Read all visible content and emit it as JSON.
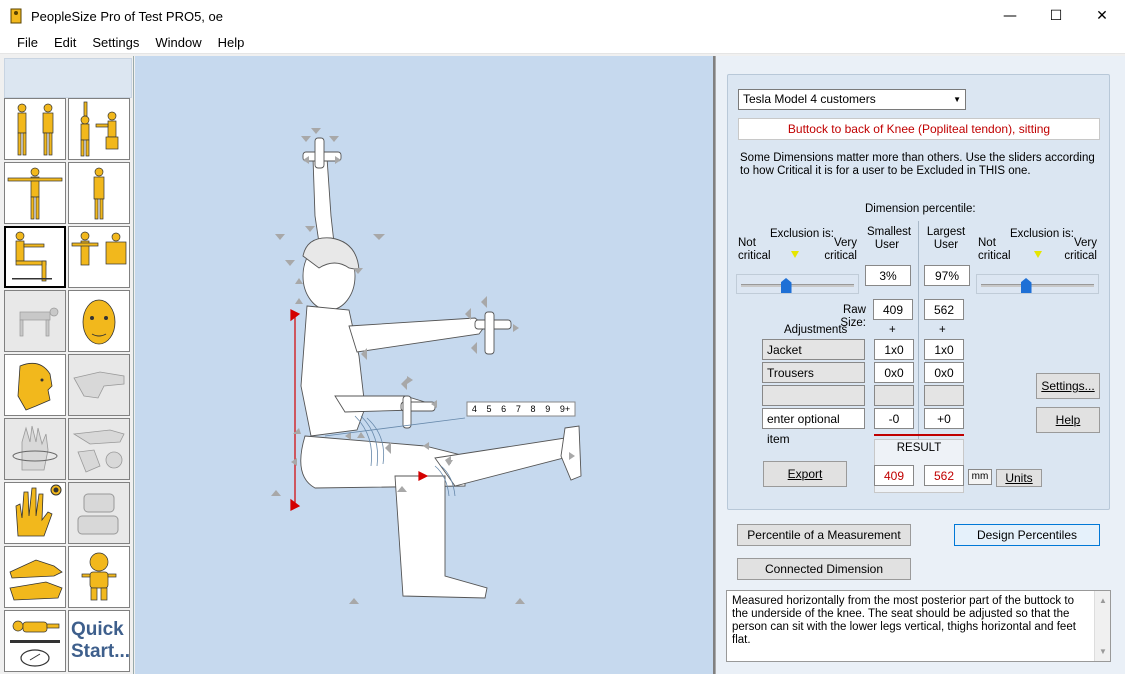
{
  "window": {
    "title": "PeopleSize Pro of Test PRO5, oe",
    "minimize": "—",
    "maximize": "☐",
    "close": "✕"
  },
  "menu": [
    "File",
    "Edit",
    "Settings",
    "Window",
    "Help"
  ],
  "palette": {
    "quick_start": "Quick Start..."
  },
  "canvas": {
    "ruler_labels": [
      "4",
      "5",
      "6",
      "7",
      "8",
      "9",
      "9+"
    ]
  },
  "panel": {
    "dataset": "Tesla Model 4 customers",
    "dimension_name": "Buttock to back of Knee (Popliteal tendon), sitting",
    "instructions": "Some Dimensions matter more than others. Use the sliders according to how Critical it is for a user to be Excluded in THIS one.",
    "dimension_percentile_label": "Dimension percentile:",
    "smallest_user_label": "Smallest User",
    "largest_user_label": "Largest User",
    "exclusion_label": "Exclusion is:",
    "not_critical": "Not critical",
    "very_critical": "Very critical",
    "smallest_percentile": "3%",
    "largest_percentile": "97%",
    "raw_size_label": "Raw Size:",
    "raw_small": "409",
    "raw_large": "562",
    "adjustments_label": "Adjustments",
    "plus": "+",
    "adjustments": [
      {
        "name": "Jacket",
        "small": "1x0",
        "large": "1x0"
      },
      {
        "name": "Trousers",
        "small": "0x0",
        "large": "0x0"
      },
      {
        "name": "",
        "small": "",
        "large": ""
      },
      {
        "name": "enter optional item",
        "small": "-0",
        "large": "+0"
      }
    ],
    "result_label": "RESULT",
    "result_small": "409",
    "result_large": "562",
    "units_value": "mm",
    "units_button": "Units",
    "export_button": "Export",
    "settings_button": "Settings...",
    "help_button": "Help",
    "slider_left_fraction": 0.38,
    "slider_right_fraction": 0.38
  },
  "modes": {
    "percentile_of_measurement": "Percentile of a Measurement",
    "design_percentiles": "Design Percentiles",
    "connected_dimension": "Connected Dimension"
  },
  "description": "Measured horizontally from the most posterior part of the buttock to the underside of the knee. The seat should be adjusted so that the person can sit with the lower legs vertical, thighs horizontal and feet flat.",
  "colors": {
    "canvas_bg": "#c6d9ee",
    "accent_red": "#c00000",
    "icon_orange": "#f2b81c",
    "slider_thumb": "#1e70d6"
  }
}
